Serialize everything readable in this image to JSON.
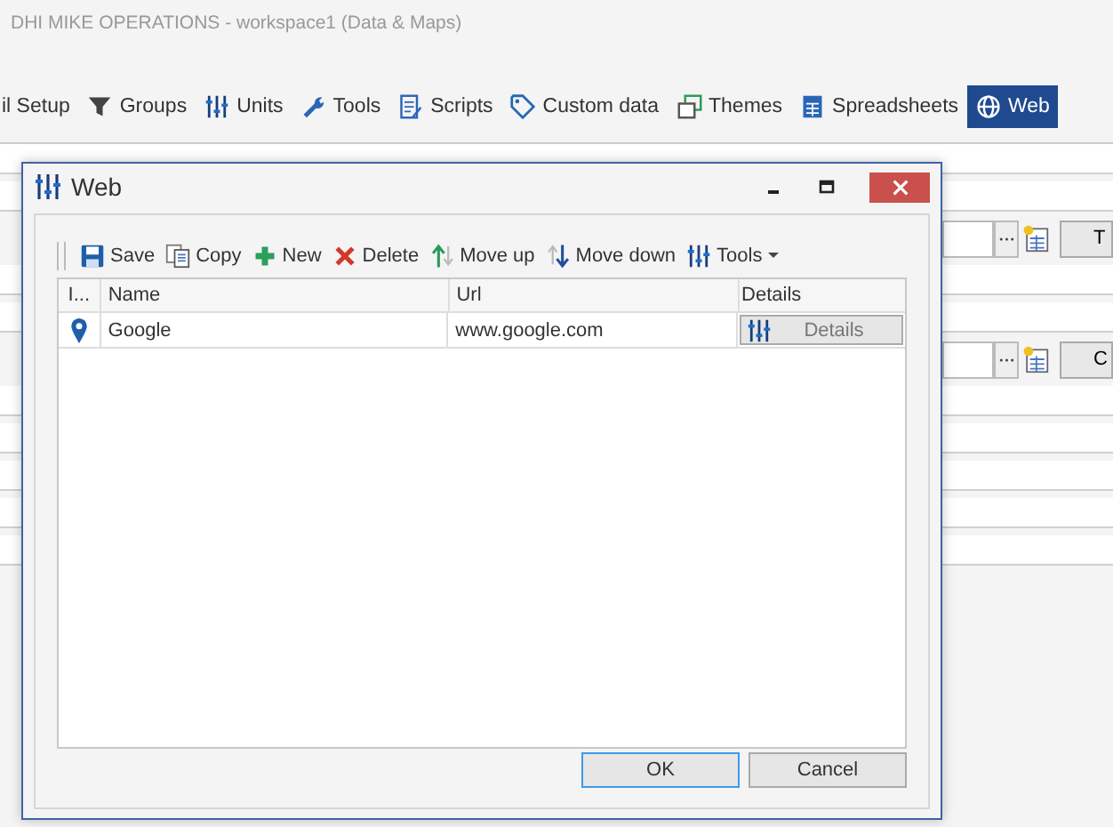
{
  "window": {
    "title": "DHI MIKE OPERATIONS - workspace1 (Data & Maps)"
  },
  "ribbon_tabs": [
    {
      "label": "il Setup",
      "selected": false
    },
    {
      "label": "Groups",
      "selected": false
    },
    {
      "label": "Units",
      "selected": false
    },
    {
      "label": "Tools",
      "selected": false
    },
    {
      "label": "Scripts",
      "selected": false
    },
    {
      "label": "Custom data",
      "selected": false
    },
    {
      "label": "Themes",
      "selected": false
    },
    {
      "label": "Spreadsheets",
      "selected": false
    },
    {
      "label": "Web",
      "selected": true
    }
  ],
  "background_fields": [
    {
      "button": "T"
    },
    {
      "button": "C"
    }
  ],
  "dialog": {
    "title": "Web",
    "toolbar": [
      "Save",
      "Copy",
      "New",
      "Delete",
      "Move up",
      "Move down",
      "Tools"
    ],
    "table": {
      "columns": [
        "I...",
        "Name",
        "Url",
        "Details"
      ],
      "rows": [
        {
          "name": "Google",
          "url": "www.google.com",
          "details": "Details"
        }
      ]
    },
    "buttons": [
      {
        "label": "OK",
        "default": true
      },
      {
        "label": "Cancel",
        "default": false
      }
    ]
  }
}
